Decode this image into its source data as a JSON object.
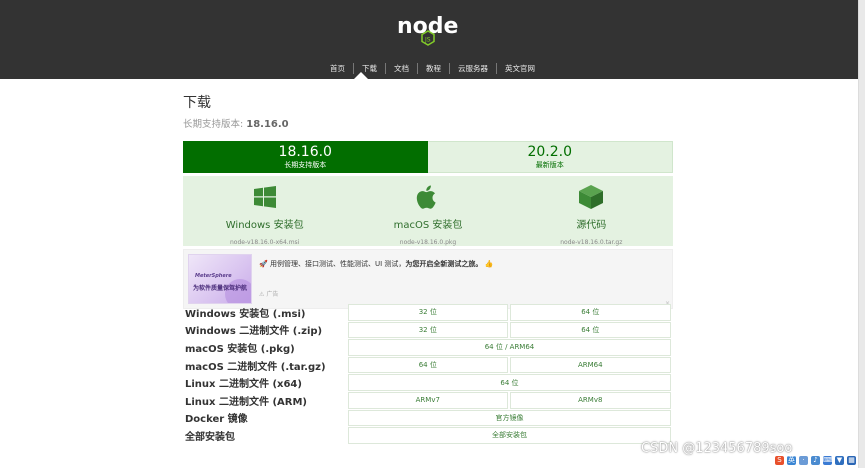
{
  "header": {
    "logo_text": "node",
    "nav": [
      {
        "label": "首页"
      },
      {
        "label": "下载"
      },
      {
        "label": "文档"
      },
      {
        "label": "教程"
      },
      {
        "label": "云服务器"
      },
      {
        "label": "英文官网"
      }
    ],
    "active_nav": "下载"
  },
  "page": {
    "title": "下载",
    "lts_prefix": "长期支持版本: ",
    "lts_version": "18.16.0"
  },
  "versions": [
    {
      "version": "18.16.0",
      "label": "长期支持版本",
      "active": true
    },
    {
      "version": "20.2.0",
      "label": "最新版本",
      "active": false
    }
  ],
  "downloads": [
    {
      "label": "Windows 安装包",
      "file": "node-v18.16.0-x64.msi",
      "icon": "windows-icon"
    },
    {
      "label": "macOS 安装包",
      "file": "node-v18.16.0.pkg",
      "icon": "apple-icon"
    },
    {
      "label": "源代码",
      "file": "node-v18.16.0.tar.gz",
      "icon": "box-icon"
    }
  ],
  "ad": {
    "image_line1": "MeterSphere",
    "image_line2": "为软件质量保驾护航",
    "text": "用例管理、接口测试、性能测试、UI 测试，",
    "text_bold": "为您开启全新测试之旅。",
    "mark": "广告",
    "close": "×"
  },
  "table": [
    {
      "label": "Windows 安装包 (.msi)",
      "cells": [
        "32 位",
        "64 位"
      ]
    },
    {
      "label": "Windows 二进制文件 (.zip)",
      "cells": [
        "32 位",
        "64 位"
      ]
    },
    {
      "label": "macOS 安装包 (.pkg)",
      "cells": [
        "64 位 / ARM64"
      ]
    },
    {
      "label": "macOS 二进制文件 (.tar.gz)",
      "cells": [
        "64 位",
        "ARM64"
      ]
    },
    {
      "label": "Linux 二进制文件 (x64)",
      "cells": [
        "64 位"
      ]
    },
    {
      "label": "Linux 二进制文件 (ARM)",
      "cells": [
        "ARMv7",
        "ARMv8"
      ]
    },
    {
      "label": "Docker 镜像",
      "cells": [
        "官方镜像"
      ]
    },
    {
      "label": "全部安装包",
      "cells": [
        "全部安装包"
      ]
    }
  ],
  "watermark": "CSDN @123456789soo",
  "colors": {
    "header_bg": "#333333",
    "brand_green": "#026e00",
    "light_green": "#e4f2e1",
    "link_green": "#3a7d36"
  }
}
